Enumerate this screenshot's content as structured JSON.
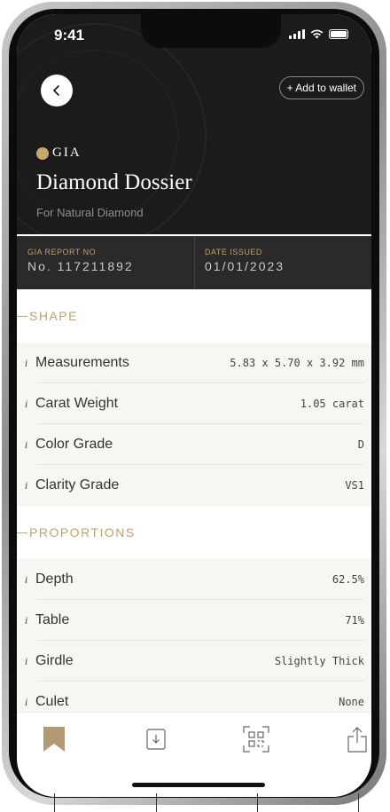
{
  "status_bar": {
    "time": "9:41"
  },
  "header": {
    "wallet_button": "+ Add to wallet",
    "brand": "GIA",
    "title": "Diamond Dossier",
    "subtitle": "For Natural Diamond"
  },
  "report": {
    "report_no_label": "GIA REPORT NO",
    "report_no": "No. 117211892",
    "date_label": "DATE ISSUED",
    "date": "01/01/2023"
  },
  "sections": [
    {
      "title": "SHAPE",
      "rows": [
        {
          "label": "Measurements",
          "value": "5.83 x 5.70 x 3.92 mm"
        },
        {
          "label": "Carat Weight",
          "value": "1.05 carat"
        },
        {
          "label": "Color Grade",
          "value": "D"
        },
        {
          "label": "Clarity Grade",
          "value": "VS1"
        }
      ]
    },
    {
      "title": "PROPORTIONS",
      "rows": [
        {
          "label": "Depth",
          "value": "62.5%"
        },
        {
          "label": "Table",
          "value": "71%"
        },
        {
          "label": "Girdle",
          "value": "Slightly Thick"
        },
        {
          "label": "Culet",
          "value": "None"
        }
      ]
    }
  ],
  "info_glyph": "i",
  "icons": [
    "back-chevron-icon",
    "bookmark-icon",
    "download-icon",
    "qr-scan-icon",
    "share-icon"
  ],
  "colors": {
    "gold": "#bfa26c",
    "dark": "#1b1b1b"
  }
}
